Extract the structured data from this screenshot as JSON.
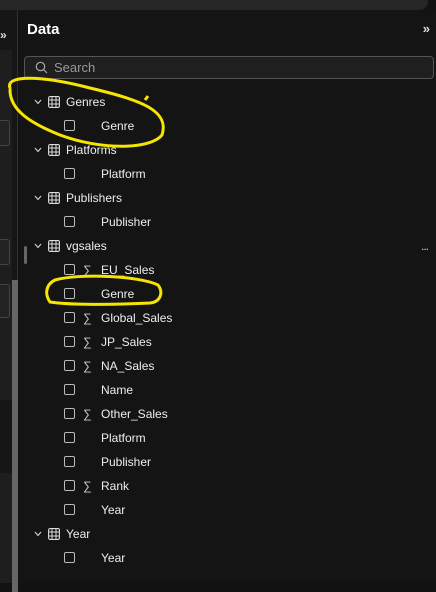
{
  "panel": {
    "title": "Data",
    "collapse_icon": "double-chevron-right",
    "search_placeholder": "Search"
  },
  "tables": [
    {
      "name": "Genres",
      "fields": [
        {
          "name": "Genre",
          "sigma": false
        }
      ]
    },
    {
      "name": "Platforms",
      "fields": [
        {
          "name": "Platform",
          "sigma": false
        }
      ]
    },
    {
      "name": "Publishers",
      "fields": [
        {
          "name": "Publisher",
          "sigma": false
        }
      ]
    },
    {
      "name": "vgsales",
      "more": "...",
      "fields": [
        {
          "name": "EU_Sales",
          "sigma": true
        },
        {
          "name": "Genre",
          "sigma": false
        },
        {
          "name": "Global_Sales",
          "sigma": true
        },
        {
          "name": "JP_Sales",
          "sigma": true
        },
        {
          "name": "NA_Sales",
          "sigma": true
        },
        {
          "name": "Name",
          "sigma": false
        },
        {
          "name": "Other_Sales",
          "sigma": true
        },
        {
          "name": "Platform",
          "sigma": false
        },
        {
          "name": "Publisher",
          "sigma": false
        },
        {
          "name": "Rank",
          "sigma": true
        },
        {
          "name": "Year",
          "sigma": false
        }
      ]
    },
    {
      "name": "Year",
      "fields": [
        {
          "name": "Year",
          "sigma": false
        }
      ]
    }
  ],
  "sigma_glyph": "∑",
  "annotation_color": "#f5e500"
}
